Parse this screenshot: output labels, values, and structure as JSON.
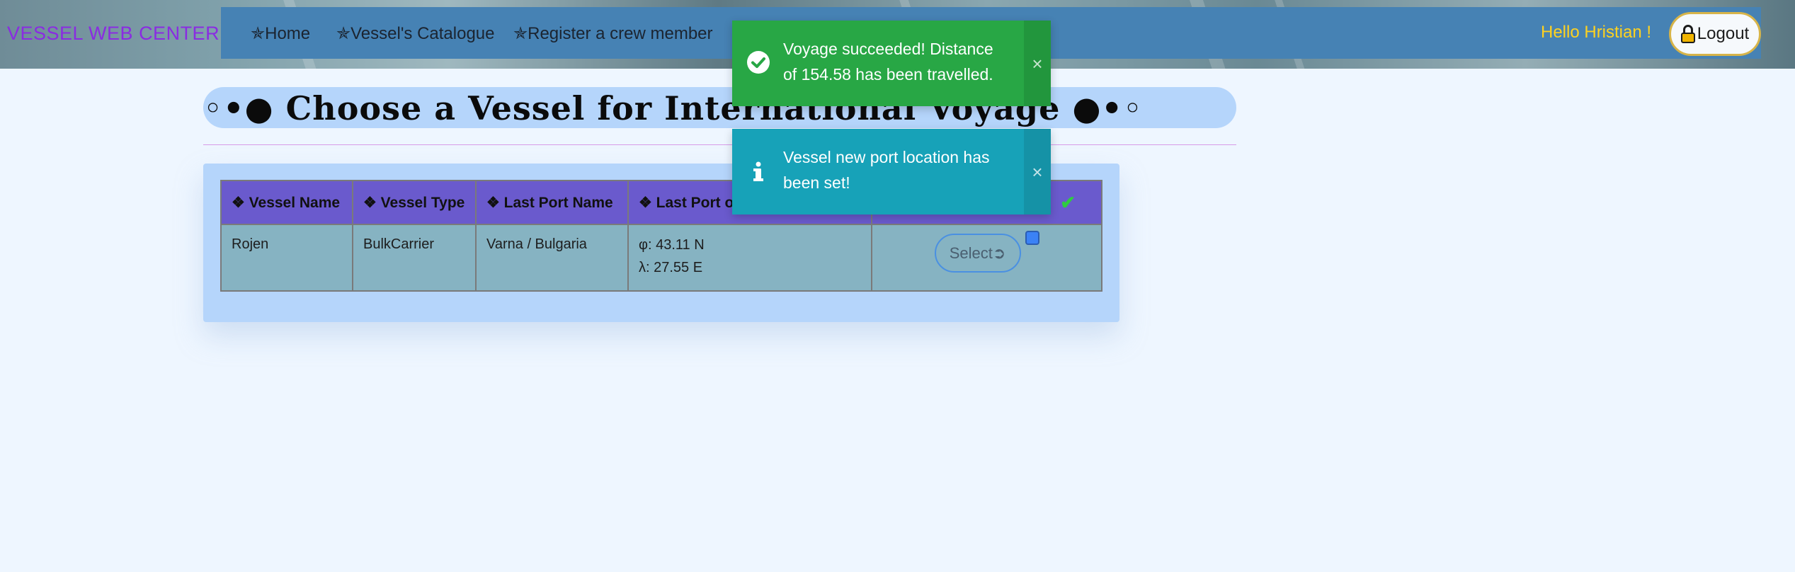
{
  "header": {
    "brand": "VESSEL WEB CENTER",
    "nav": [
      {
        "label": "✯Home"
      },
      {
        "label": "✯Vessel's Catalogue"
      },
      {
        "label": "✯Register a crew member"
      }
    ],
    "greeting": "Hello Hristian !",
    "logout_label": "Logout"
  },
  "page": {
    "title": "◦•● Choose a Vessel for International Voyage ●•◦"
  },
  "table": {
    "columns": [
      "❖ Vessel Name",
      "❖ Vessel Type",
      "❖ Last Port Name",
      "❖ Last Port of Call Coordinates",
      ""
    ],
    "rows": [
      {
        "vessel_name": "Rojen",
        "vessel_type": "BulkCarrier",
        "last_port": "Varna / Bulgaria",
        "lat": "φ: 43.11 N",
        "lon": "λ: 27.55 E",
        "action_label": "Select➲"
      }
    ]
  },
  "toasts": [
    {
      "type": "success",
      "message": "Voyage succeeded! Distance of 154.58 has been travelled.",
      "close": "×"
    },
    {
      "type": "info",
      "message": "Vessel new port location has been set!",
      "close": "×"
    }
  ],
  "colors": {
    "navbar": "#4682b4",
    "brand": "#8a2be2",
    "greeting": "#ffd21f",
    "table_header": "#6a5acd",
    "table_row": "#86b3c2",
    "toast_success": "#28a745",
    "toast_info": "#17a2b8"
  }
}
